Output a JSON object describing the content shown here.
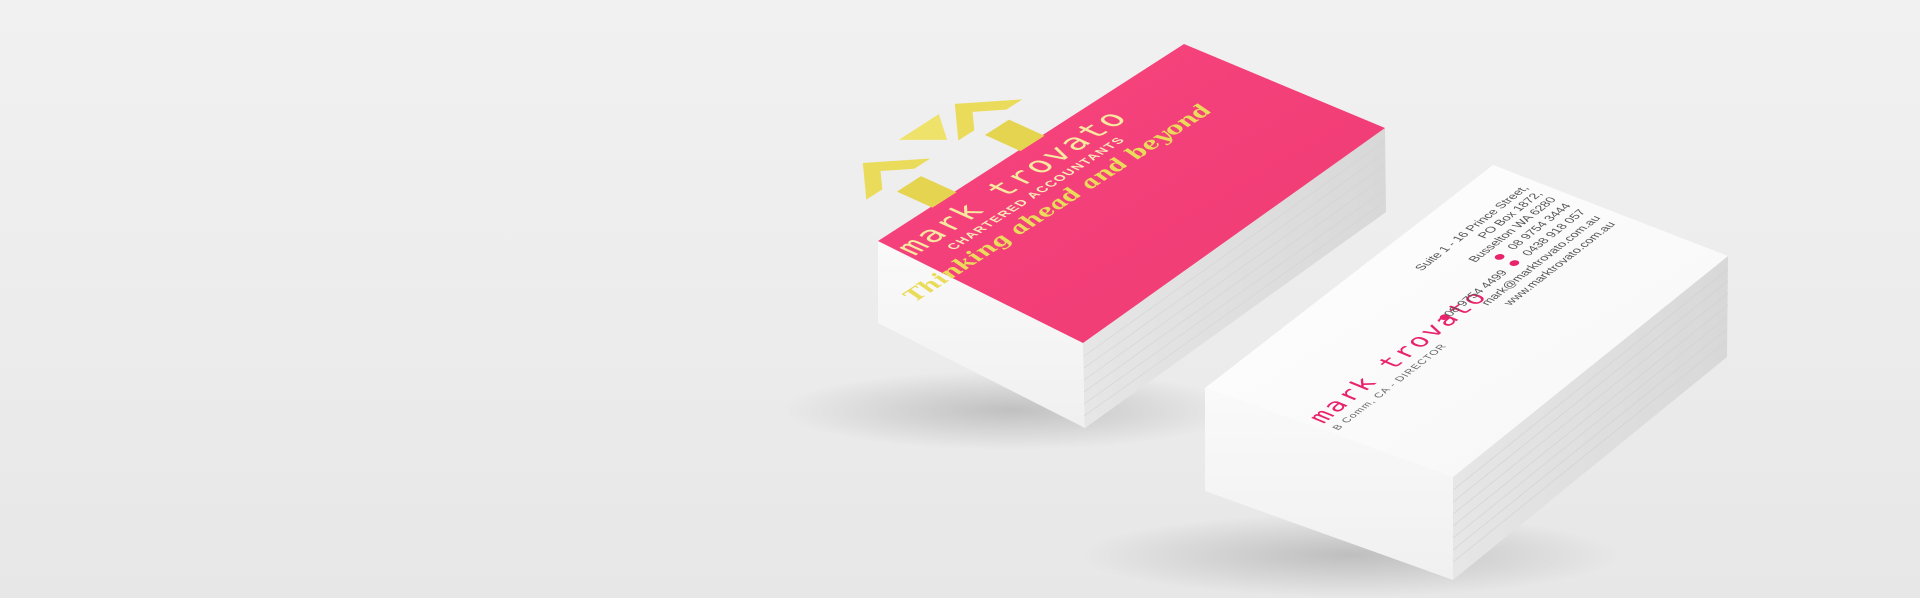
{
  "colors": {
    "card_pink": "#f4407a",
    "logo_gold": "#eadc5a",
    "back_accent": "#e8236b",
    "background": "#eeeeee"
  },
  "front_card": {
    "logo_icon": "geometric-arrows-logo",
    "brand_name": "mark trovato",
    "subtitle": "CHARTERED ACCOUNTANTS",
    "tagline": "Thinking ahead and beyond"
  },
  "back_card": {
    "brand_name": "mark trovato",
    "credentials": "B Comm, CA - DIRECTOR",
    "address_line1": "Suite 1 - 16 Prince Street,",
    "address_line2": "PO Box 1872,",
    "address_line3": "Busselton WA 6280",
    "phone": "08 9754 3444",
    "fax": "08 9754 4499",
    "mobile": "0438 918 057",
    "email": "mark@marktrovato.com.au",
    "website": "www.marktrovato.com.au"
  }
}
